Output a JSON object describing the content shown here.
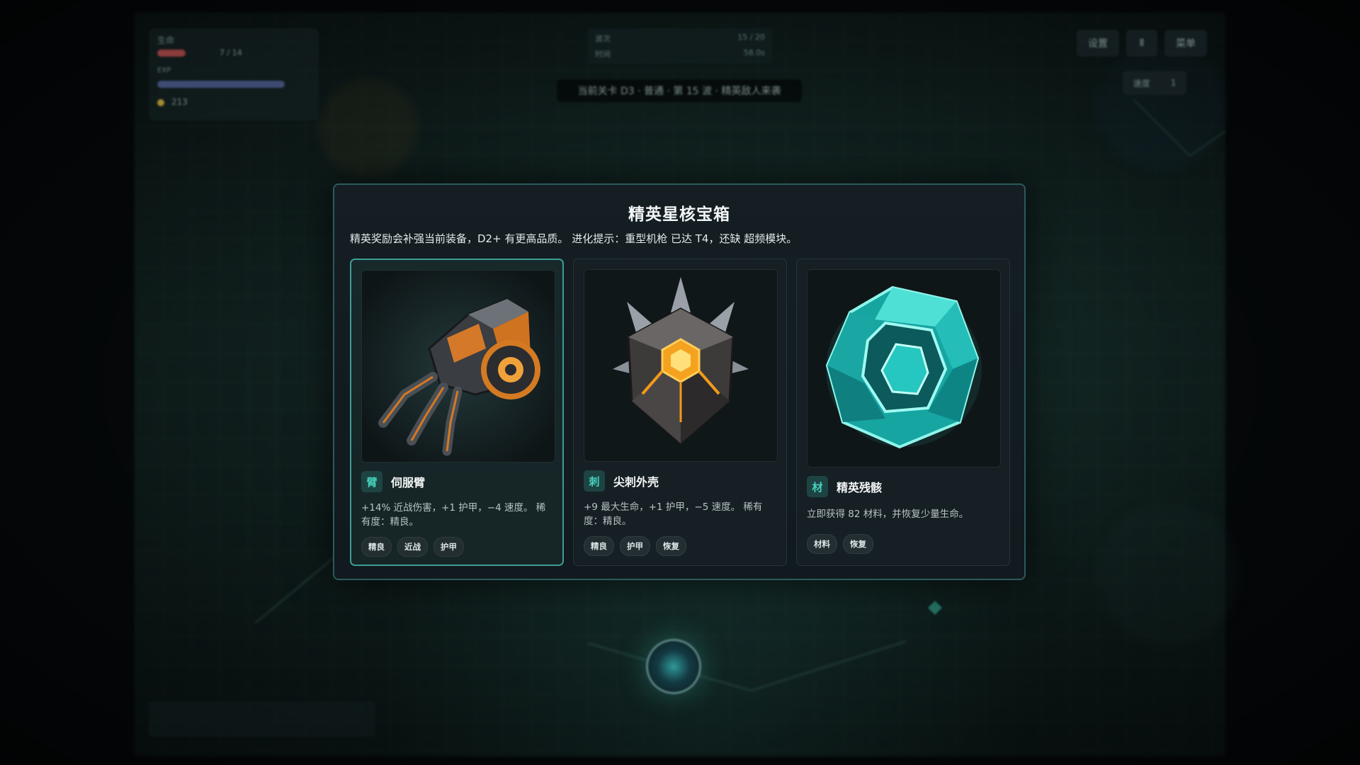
{
  "background": {
    "hud_left": {
      "label_top": "生命",
      "hp_text": "7 / 14",
      "label_xp": "EXP",
      "coins": "213"
    },
    "hud_center": {
      "row1_label": "波次",
      "row1_value": "15 / 20",
      "row2_label": "时间",
      "row2_value": "58.0s"
    },
    "wave_banner": "当前关卡 D3 · 普通 · 第 15 波 · 精英敌人来袭",
    "hud_buttons": [
      "设置",
      "Ⅱ",
      "菜单"
    ],
    "speed": {
      "label": "速度",
      "value": "1"
    }
  },
  "modal": {
    "title": "精英星核宝箱",
    "subtitle": "精英奖励会补强当前装备，D2+ 有更高品质。 进化提示：重型机枪 已达 T4，还缺 超频模块。",
    "accent": "#3e9c95",
    "cards": [
      {
        "badge": "臂",
        "name": "伺服臂",
        "icon": "servo-arm-icon",
        "desc": "+14% 近战伤害，+1 护甲，−4 速度。 稀有度：精良。",
        "tags": [
          "精良",
          "近战",
          "护甲"
        ],
        "selected": true
      },
      {
        "badge": "刺",
        "name": "尖刺外壳",
        "icon": "spiked-shell-icon",
        "desc": "+9 最大生命，+1 护甲，−5 速度。 稀有度：精良。",
        "tags": [
          "精良",
          "护甲",
          "恢复"
        ],
        "selected": false
      },
      {
        "badge": "材",
        "name": "精英残骸",
        "icon": "crystal-material-icon",
        "desc": "立即获得 82 材料，并恢复少量生命。",
        "tags": [
          "材料",
          "恢复"
        ],
        "selected": false
      }
    ]
  }
}
